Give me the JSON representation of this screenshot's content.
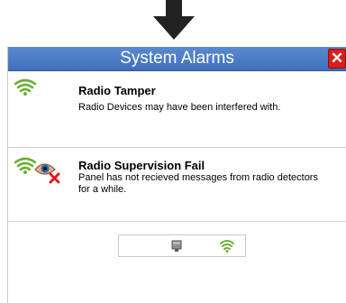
{
  "dialog": {
    "title": "System Alarms",
    "close_label": "✕"
  },
  "alarms": [
    {
      "title": "Radio Tamper",
      "description": "Radio Devices may have been interfered with.",
      "icon": "wifi-signal-icon"
    },
    {
      "title": "Radio Supervision Fail",
      "description": "Panel has not recieved messages from radio detectors for a while.",
      "icon": "wifi-signal-eye-blocked-icon"
    }
  ],
  "pager": {
    "icons": [
      "device-icon",
      "wifi-signal-icon"
    ]
  },
  "colors": {
    "titlebar": "#4a7cc3",
    "close": "#d81f1f",
    "signal": "#6ab033"
  }
}
